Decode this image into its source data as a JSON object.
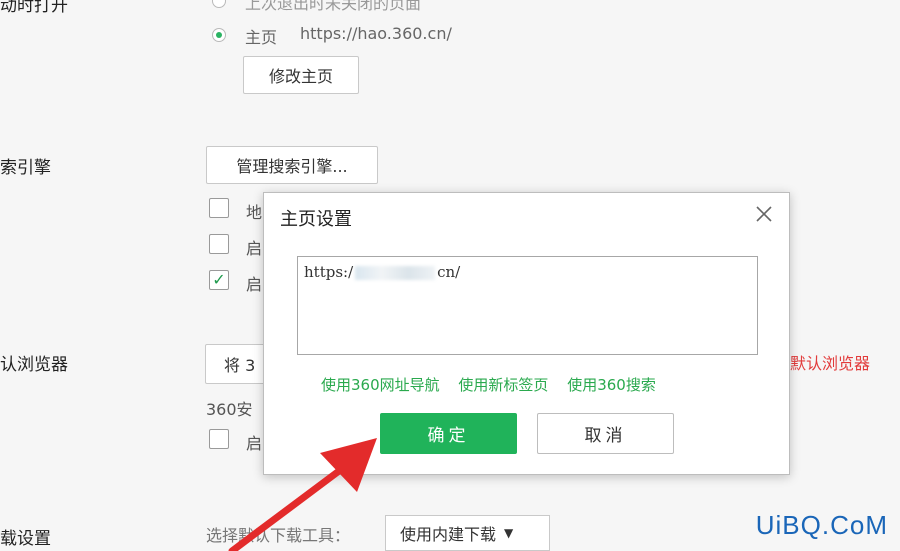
{
  "left_labels": {
    "startup": "动时打开",
    "search_engine": "索引擎",
    "default_browser": "认浏览器",
    "download": "载设置"
  },
  "startup": {
    "option_last_closed": "上次退出时未关闭的页面",
    "option_home_label": "主页",
    "option_home_url": "https://hao.360.cn/",
    "modify_home_button": "修改主页"
  },
  "search": {
    "manage_button": "管理搜索引擎..."
  },
  "partial": {
    "cb1_text": "地",
    "cb2_text": "启",
    "cb3_text": "启",
    "default_btn_text": "将 3",
    "safe_text": "360安",
    "cb4_text": "启",
    "red_text": "默认浏览器"
  },
  "download": {
    "select_label": "选择默认下载工具：",
    "select_value": "使用内建下载"
  },
  "dialog": {
    "title": "主页设置",
    "input_prefix": "https:/",
    "input_suffix": "cn/",
    "link_nav": "使用360网址导航",
    "link_newtab": "使用新标签页",
    "link_search": "使用360搜索",
    "ok_button": "确定",
    "cancel_button": "取消"
  },
  "watermark": "UiBQ.CoM",
  "colors": {
    "accent_green": "#20b35a",
    "link_green": "#2aa94e",
    "arrow_red": "#e32b2b",
    "watermark_blue": "#1a66b8"
  }
}
